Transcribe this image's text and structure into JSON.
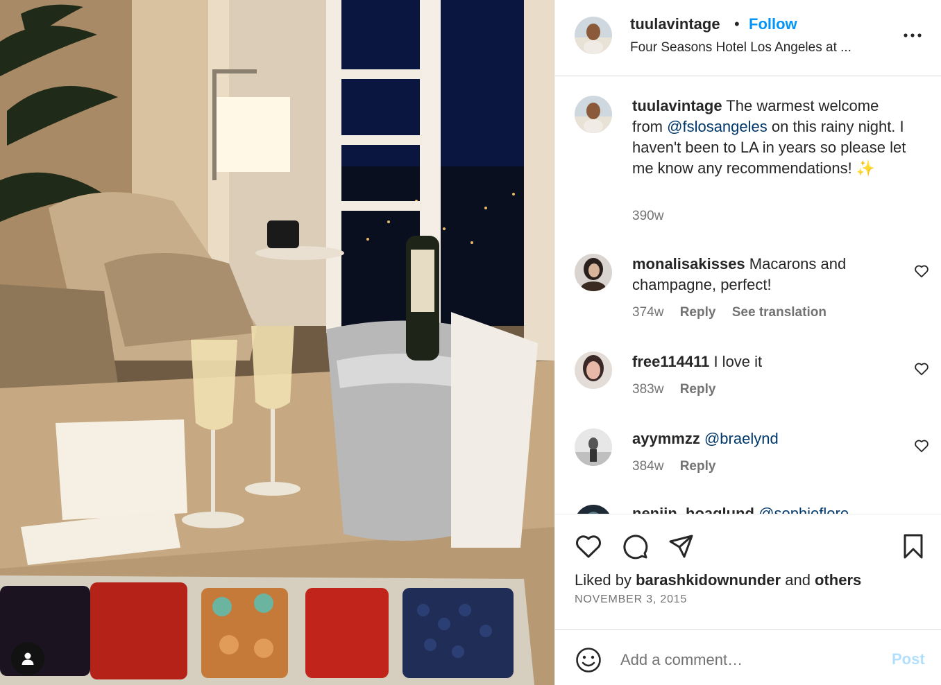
{
  "photo": {
    "alt_icon": "person-icon"
  },
  "header": {
    "username": "tuulavintage",
    "separator": "•",
    "follow_label": "Follow",
    "location": "Four Seasons Hotel Los Angeles at ...",
    "more_icon": "more-horizontal-icon"
  },
  "caption": {
    "username": "tuulavintage",
    "text_before": " The warmest welcome from ",
    "mention": "@fslosangeles",
    "text_after": " on this rainy night. I haven't been to LA in years so please let me know any recommendations! ✨",
    "time": "390w"
  },
  "comments": [
    {
      "username": "monalisakisses",
      "text": " Macarons and champagne, perfect!",
      "time": "374w",
      "reply": "Reply",
      "translate": "See translation"
    },
    {
      "username": "free114411",
      "text": " I love it",
      "time": "383w",
      "reply": "Reply"
    },
    {
      "username": "ayymmzz",
      "mention": "@braelynd",
      "time": "384w",
      "reply": "Reply"
    },
    {
      "username": "nenjin_hoaglund",
      "mention": "@sophieflore"
    }
  ],
  "actions": {
    "liked_by_prefix": "Liked by ",
    "liked_by_user": "barashkidownunder",
    "liked_by_and": " and ",
    "liked_by_others": "others",
    "date": "NOVEMBER 3, 2015"
  },
  "add_comment": {
    "placeholder": "Add a comment…",
    "post_label": "Post"
  },
  "colors": {
    "follow_blue": "#0095f6",
    "mention_blue": "#00376b",
    "post_disabled": "#b2dffc",
    "secondary_text": "#737373"
  }
}
